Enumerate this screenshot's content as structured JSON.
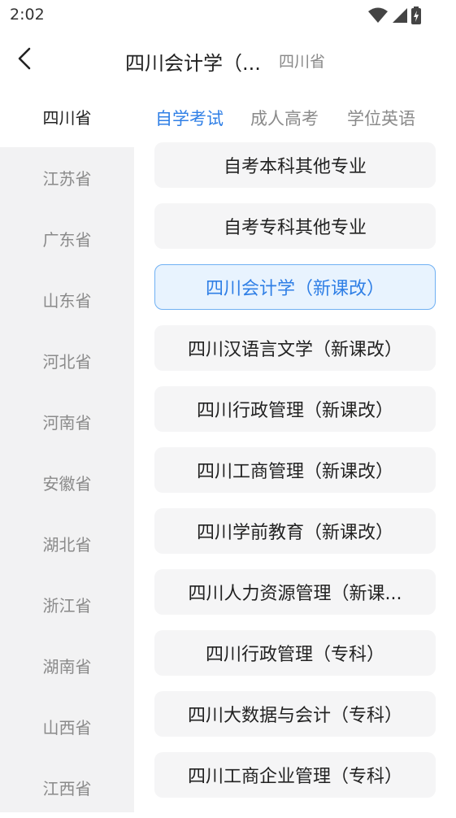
{
  "status_bar": {
    "time": "2:02",
    "icons": [
      "wifi-icon",
      "signal-icon",
      "battery-charging-icon"
    ]
  },
  "header": {
    "title": "四川会计学（...",
    "subtitle": "四川省"
  },
  "sidebar": {
    "items": [
      {
        "label": "四川省",
        "active": true
      },
      {
        "label": "江苏省"
      },
      {
        "label": "广东省"
      },
      {
        "label": "山东省"
      },
      {
        "label": "河北省"
      },
      {
        "label": "河南省"
      },
      {
        "label": "安徽省"
      },
      {
        "label": "湖北省"
      },
      {
        "label": "浙江省"
      },
      {
        "label": "湖南省"
      },
      {
        "label": "山西省"
      },
      {
        "label": "江西省"
      }
    ]
  },
  "tabs": [
    {
      "label": "自学考试",
      "active": true
    },
    {
      "label": "成人高考"
    },
    {
      "label": "学位英语"
    }
  ],
  "majors": [
    {
      "label": "自考本科其他专业"
    },
    {
      "label": "自考专科其他专业"
    },
    {
      "label": "四川会计学（新课改）",
      "selected": true
    },
    {
      "label": "四川汉语言文学（新课改）"
    },
    {
      "label": "四川行政管理（新课改）"
    },
    {
      "label": "四川工商管理（新课改）"
    },
    {
      "label": "四川学前教育（新课改）"
    },
    {
      "label": "四川人力资源管理（新课..."
    },
    {
      "label": "四川行政管理（专科）"
    },
    {
      "label": "四川大数据与会计（专科）"
    },
    {
      "label": "四川工商企业管理（专科）"
    }
  ],
  "colors": {
    "accent": "#2f7fe6",
    "selected_bg": "#e8f3fe",
    "selected_border": "#6fb0f3",
    "sidebar_bg": "#f2f2f3"
  }
}
